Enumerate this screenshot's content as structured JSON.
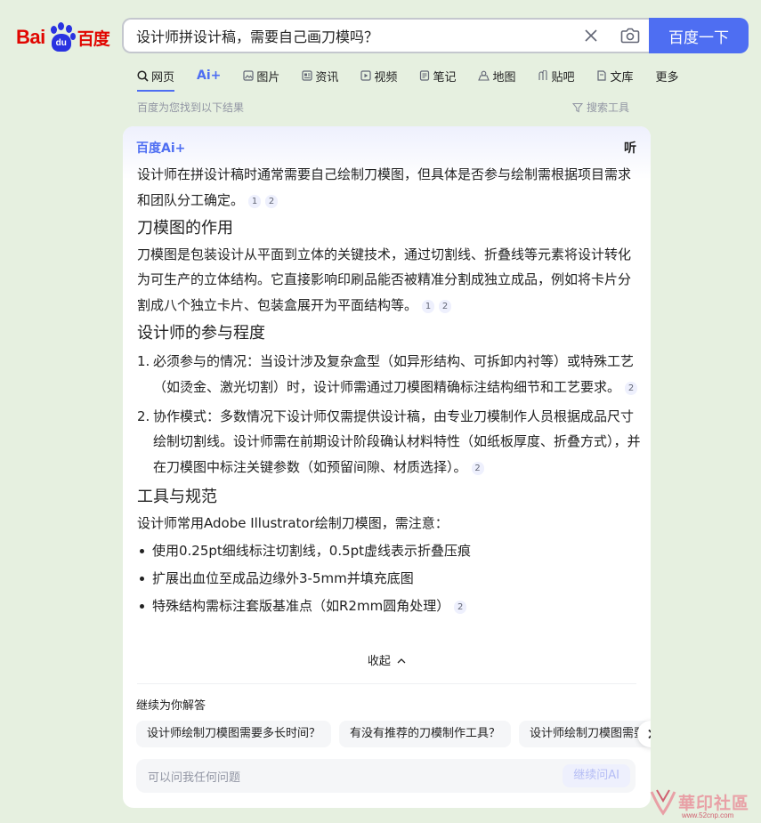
{
  "logo": {
    "bai": "Bai",
    "du": "du",
    "cn": "百度"
  },
  "search": {
    "query": "设计师拼设计稿，需要自己画刀模吗？",
    "button": "百度一下"
  },
  "tabs": [
    {
      "label": "网页",
      "icon": "search-icon"
    },
    {
      "label": "Ai+",
      "icon": "ai-icon"
    },
    {
      "label": "图片",
      "icon": "image-icon"
    },
    {
      "label": "资讯",
      "icon": "news-icon"
    },
    {
      "label": "视频",
      "icon": "video-icon"
    },
    {
      "label": "笔记",
      "icon": "note-icon"
    },
    {
      "label": "地图",
      "icon": "map-icon"
    },
    {
      "label": "贴吧",
      "icon": "tieba-icon"
    },
    {
      "label": "文库",
      "icon": "wenku-icon"
    },
    {
      "label": "更多",
      "icon": ""
    }
  ],
  "results_info": "百度为您找到以下结果",
  "search_tools": "搜索工具",
  "ai_card": {
    "brand": "百度Ai+",
    "listen": "听",
    "intro": "设计师在拼设计稿时通常需要自己绘制刀模图，但具体是否参与绘制需根据项目需求和团队分工确定。",
    "intro_cites": [
      "1",
      "2"
    ],
    "h1": "刀模图的作用",
    "p1": "刀模图是包装设计从平面到立体的关键技术，通过切割线、折叠线等元素将设计转化为可生产的立体结构。它直接影响印刷品能否被精准分割成独立成品，例如将卡片分割成八个独立卡片、包装盒展开为平面结构等。",
    "p1_cites": [
      "1",
      "2"
    ],
    "h2": "设计师的参与程度",
    "ol": [
      {
        "num": "1.",
        "text": "必须参与的情况：当设计涉及复杂盒型（如异形结构、可拆卸内衬等）或特殊工艺（如烫金、激光切割）时，设计师需通过刀模图精确标注结构细节和工艺要求。",
        "cite": "2"
      },
      {
        "num": "2.",
        "text": "协作模式：多数情况下设计师仅需提供设计稿，由专业刀模制作人员根据成品尺寸绘制切割线。设计师需在前期设计阶段确认材料特性（如纸板厚度、折叠方式），并在刀模图中标注关键参数（如预留间隙、材质选择）。",
        "cite": "2"
      }
    ],
    "h3": "工具与规范",
    "p3": "设计师常用Adobe Illustrator绘制刀模图，需注意：",
    "ul": [
      {
        "text": "使用0.25pt细线标注切割线，0.5pt虚线表示折叠压痕",
        "cite": ""
      },
      {
        "text": "扩展出血位至成品边缘外3-5mm并填充底图",
        "cite": ""
      },
      {
        "text": "特殊结构需标注套版基准点（如R2mm圆角处理）",
        "cite": "2"
      }
    ],
    "collapse": "收起",
    "continue_title": "继续为你解答",
    "chips": [
      "设计师绘制刀模图需要多长时间？",
      "有没有推荐的刀模制作工具？",
      "设计师绘制刀模图需要"
    ],
    "ask_placeholder": "可以问我任何问题",
    "ask_button": "继续问AI"
  },
  "watermark": {
    "text": "華印社區",
    "url": "www.52cnp.com"
  }
}
